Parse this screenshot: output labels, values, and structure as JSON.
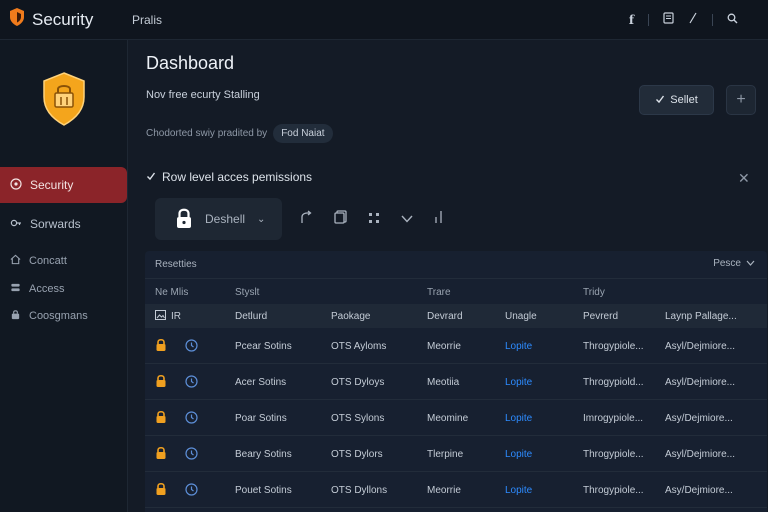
{
  "app": {
    "title": "Security"
  },
  "topbar": {
    "title": "Pralis",
    "icons": [
      "facebook-icon",
      "document-icon",
      "edit-icon",
      "search-icon"
    ]
  },
  "sidebar": {
    "items": [
      {
        "label": "Security",
        "icon": "security-icon",
        "active": true
      },
      {
        "label": "Sorwards",
        "icon": "key-icon"
      },
      {
        "label": "Concatt",
        "icon": "home-icon"
      },
      {
        "label": "Access",
        "icon": "database-icon"
      },
      {
        "label": "Coosgmans",
        "icon": "lock-icon"
      }
    ]
  },
  "page": {
    "title": "Dashboard",
    "subtitle": "Nov free ecurty Stalling",
    "meta_label": "Chodorted swiy pradited by",
    "meta_pill": "Fod Naiat"
  },
  "buttons": {
    "primary_label": "Sellet",
    "add_label": "+"
  },
  "section": {
    "title": "Row level acces pemissions"
  },
  "toolbar": {
    "select_label": "Deshell"
  },
  "table": {
    "title": "Resetties",
    "filter_label": "Pesce",
    "group_headers": [
      "Ne Mlis",
      "Styslt",
      "Trare",
      "Tridy"
    ],
    "columns": [
      "IR",
      "Detlurd",
      "Paokage",
      "Devrard",
      "Unagle",
      "Pevrerd",
      "Laynp Pallage..."
    ],
    "rows": [
      {
        "name": "Pcear Sotins",
        "package": "OTS Ayloms",
        "device": "Meorrie",
        "status": "Lopite",
        "perm": "Throgypiole...",
        "layer": "Asyl/Dejmiore..."
      },
      {
        "name": "Acer Sotins",
        "package": "OTS Dyloys",
        "device": "Meotiia",
        "status": "Lopite",
        "perm": "Throgypiold...",
        "layer": "Asyl/Dejmiore..."
      },
      {
        "name": "Poar Sotins",
        "package": "OTS Sylons",
        "device": "Meomine",
        "status": "Lopite",
        "perm": "Imrogypiole...",
        "layer": "Asy/Dejmiore..."
      },
      {
        "name": "Beary Sotins",
        "package": "OTS Dylors",
        "device": "Tlerpine",
        "status": "Lopite",
        "perm": "Throgypiole...",
        "layer": "Asyl/Dejmiore..."
      },
      {
        "name": "Pouet Sotins",
        "package": "OTS Dyllons",
        "device": "Meorrie",
        "status": "Lopite",
        "perm": "Throgypiole...",
        "layer": "Asy/Dejmiore..."
      }
    ]
  },
  "colors": {
    "accent_red": "#8b2429",
    "link_blue": "#2d8bff",
    "lock_orange": "#f0a020",
    "shield_orange": "#f4a51c"
  }
}
